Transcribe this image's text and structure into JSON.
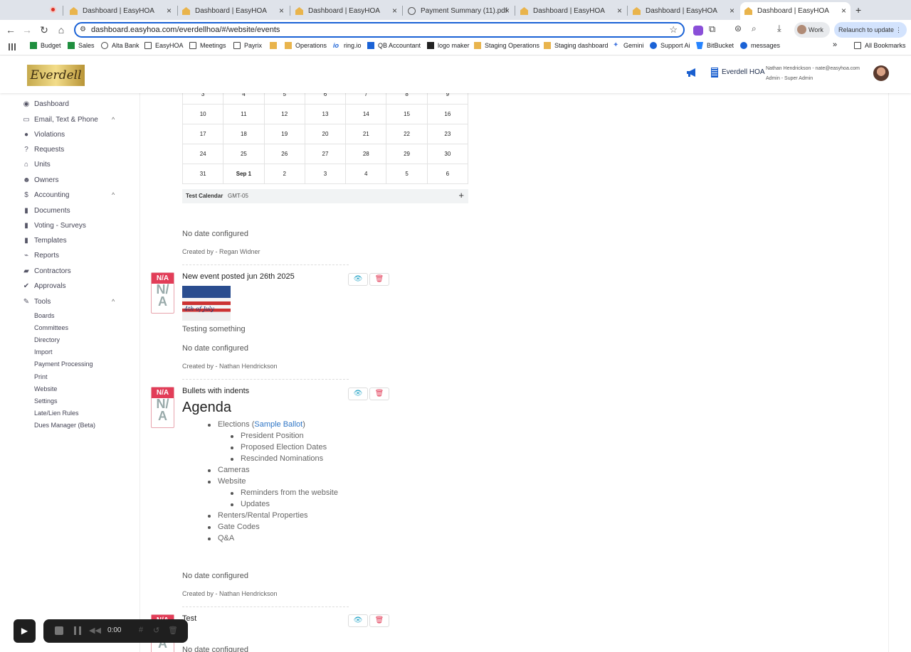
{
  "browser": {
    "tabs": [
      {
        "label": "Dashboard | EasyHOA"
      },
      {
        "label": "Dashboard | EasyHOA"
      },
      {
        "label": "Dashboard | EasyHOA"
      },
      {
        "label": "Payment Summary (11).pdf"
      },
      {
        "label": "Dashboard | EasyHOA"
      },
      {
        "label": "Dashboard | EasyHOA"
      },
      {
        "label": "Dashboard | EasyHOA"
      }
    ],
    "new_tab": "+",
    "url": "dashboard.easyhoa.com/everdellhoa/#/website/events",
    "profile_label": "Work",
    "relaunch_label": "Relaunch to update",
    "bookmarks": [
      {
        "label": "Budget"
      },
      {
        "label": "Sales"
      },
      {
        "label": "Alta Bank"
      },
      {
        "label": "EasyHOA"
      },
      {
        "label": "Meetings"
      },
      {
        "label": "Payrix"
      },
      {
        "label": "Operations"
      },
      {
        "label": "ring.io"
      },
      {
        "label": "QB Accountant"
      },
      {
        "label": "logo maker"
      },
      {
        "label": "Staging Operations"
      },
      {
        "label": "Staging dashboard"
      },
      {
        "label": "Gemini"
      },
      {
        "label": "Support Ai"
      },
      {
        "label": "BitBucket"
      },
      {
        "label": "messages"
      }
    ],
    "bookmarks_overflow": "»",
    "all_bookmarks": "All Bookmarks"
  },
  "header": {
    "logo_text": "Everdell",
    "org_name": "Everdell HOA",
    "user_line": "Nathan Hendrickson - nate@easyhoa.com",
    "role_line": "Admin - Super Admin"
  },
  "sidebar": {
    "items": [
      {
        "label": "Dashboard",
        "icon": "dashboard-icon"
      },
      {
        "label": "Email, Text & Phone",
        "icon": "inbox-icon"
      },
      {
        "label": "Violations",
        "icon": "alert-icon"
      },
      {
        "label": "Requests",
        "icon": "question-icon"
      },
      {
        "label": "Units",
        "icon": "home-icon"
      },
      {
        "label": "Owners",
        "icon": "users-icon"
      },
      {
        "label": "Accounting",
        "icon": "dollar-icon"
      },
      {
        "label": "Documents",
        "icon": "document-icon"
      },
      {
        "label": "Voting - Surveys",
        "icon": "document-icon"
      },
      {
        "label": "Templates",
        "icon": "document-icon"
      },
      {
        "label": "Reports",
        "icon": "chart-icon"
      },
      {
        "label": "Contractors",
        "icon": "truck-icon"
      },
      {
        "label": "Approvals",
        "icon": "check-icon"
      },
      {
        "label": "Tools",
        "icon": "wrench-icon"
      }
    ],
    "tools_sub": [
      "Boards",
      "Committees",
      "Directory",
      "Import",
      "Payment Processing",
      "Print",
      "Website",
      "Settings",
      "Late/Lien Rules",
      "Dues Manager (Beta)"
    ]
  },
  "calendar": {
    "rows": [
      [
        "3",
        "4",
        "5",
        "6",
        "7",
        "8",
        "9"
      ],
      [
        "10",
        "11",
        "12",
        "13",
        "14",
        "15",
        "16"
      ],
      [
        "17",
        "18",
        "19",
        "20",
        "21",
        "22",
        "23"
      ],
      [
        "24",
        "25",
        "26",
        "27",
        "28",
        "29",
        "30"
      ],
      [
        "31",
        "Sep 1",
        "2",
        "3",
        "4",
        "5",
        "6"
      ]
    ],
    "footer_name": "Test Calendar",
    "footer_tz": "GMT-05",
    "footer_add": "+"
  },
  "events": {
    "e0": {
      "date_text": "No date configured",
      "created_by": "Created by - Regan Widner"
    },
    "e1": {
      "badge_top": "N/A",
      "badge_l1": "N/",
      "badge_l2": "A",
      "title": "New event posted jun 26th 2025",
      "image_text": "4th of July",
      "description": "Testing something",
      "date_text": "No date configured",
      "created_by": "Created by - Nathan Hendrickson"
    },
    "e2": {
      "badge_top": "N/A",
      "badge_l1": "N/",
      "badge_l2": "A",
      "title": "Bullets with indents",
      "heading": "Agenda",
      "elections_pre": "Elections (",
      "elections_link": "Sample Ballot",
      "elections_post": ")",
      "list": [
        "President Position",
        "Proposed Election Dates",
        "Rescinded Nominations",
        "Cameras",
        "Website",
        "Reminders from the website",
        "Updates",
        "Renters/Rental Properties",
        "Gate Codes",
        "Q&A"
      ],
      "date_text": "No date configured",
      "created_by": "Created by - Nathan Hendrickson"
    },
    "e3": {
      "badge_top": "N/A",
      "badge_l2": "A",
      "title": "Test",
      "date_text": "No date configured"
    }
  },
  "recorder": {
    "time": "0:00"
  }
}
